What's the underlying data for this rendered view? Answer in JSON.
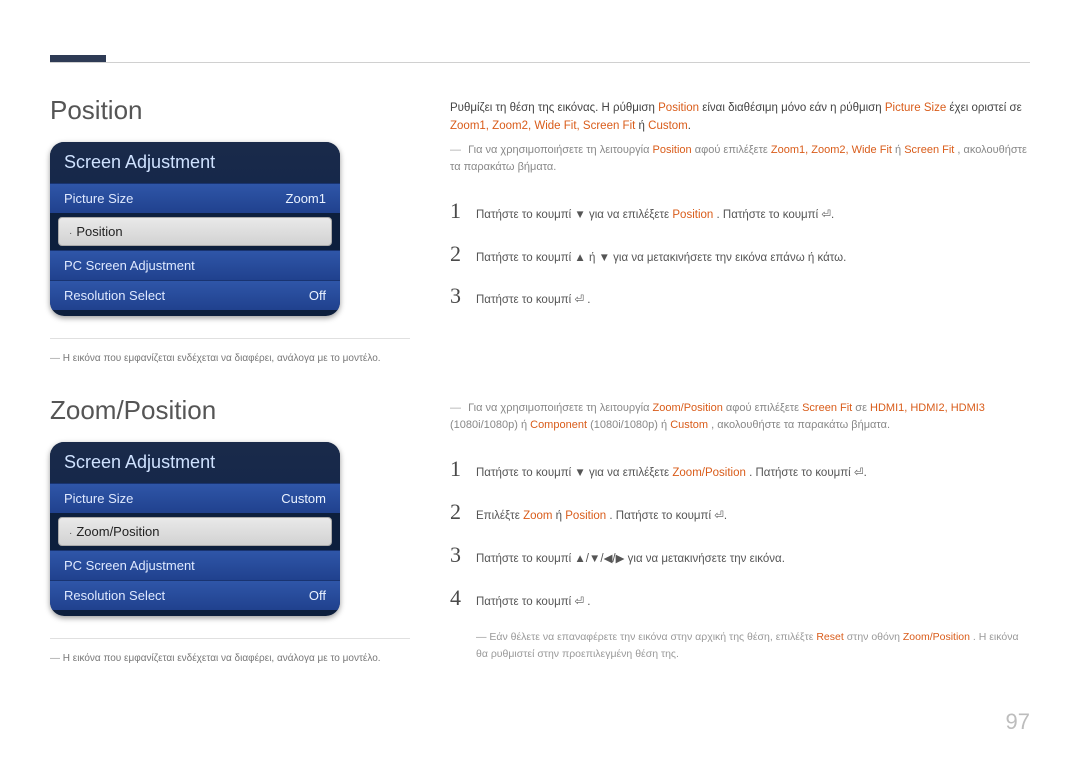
{
  "page_number": "97",
  "section1": {
    "title": "Position",
    "panel_title": "Screen Adjustment",
    "rows": [
      {
        "label": "Picture Size",
        "value": "Zoom1"
      },
      {
        "label": "Position"
      },
      {
        "label": "PC Screen Adjustment"
      },
      {
        "label": "Resolution Select",
        "value": "Off"
      }
    ],
    "note_prefix": "―",
    "note": "Η εικόνα που εμφανίζεται ενδέχεται να διαφέρει, ανάλογα με το μοντέλο.",
    "intro_a": "Ρυθμίζει τη θέση της εικόνας. Η ρύθμιση ",
    "intro_b": " είναι διαθέσιμη μόνο εάν η ρύθμιση ",
    "kw_position": "Position",
    "kw_picsize": "Picture Size",
    "intro_c": " έχει οριστεί σε ",
    "opts": "Zoom1, Zoom2, Wide Fit, Screen Fit",
    "intro_or": " ή ",
    "kw_custom": "Custom",
    "sub_a": "Για να χρησιμοποιήσετε τη λειτουργία ",
    "sub_b": " αφού επιλέξετε ",
    "sub_opts": "Zoom1, Zoom2, Wide Fit",
    "sub_or": " ή ",
    "kw_screenfit": "Screen Fit",
    "sub_c": ", ακολουθήστε τα παρακάτω βήματα.",
    "steps": {
      "s1a": "Πατήστε το κουμπί ▼ για να επιλέξετε ",
      "s1b": ". Πατήστε το κουμπί ",
      "enter": "↵",
      "s2": "Πατήστε το κουμπί ▲ ή ▼ για να μετακινήσετε την εικόνα επάνω ή κάτω.",
      "s3a": "Πατήστε το κουμπί ",
      "s3b": "."
    }
  },
  "section2": {
    "title": "Zoom/Position",
    "panel_title": "Screen Adjustment",
    "rows": [
      {
        "label": "Picture Size",
        "value": "Custom"
      },
      {
        "label": "Zoom/Position"
      },
      {
        "label": "PC Screen Adjustment"
      },
      {
        "label": "Resolution Select",
        "value": "Off"
      }
    ],
    "note_prefix": "―",
    "note": "Η εικόνα που εμφανίζεται ενδέχεται να διαφέρει, ανάλογα με το μοντέλο.",
    "sub_a": "Για να χρησιμοποιήσετε τη λειτουργία ",
    "kw_zp": "Zoom/Position",
    "sub_b": " αφού επιλέξετε ",
    "kw_screenfit": "Screen Fit",
    "sub_c": " σε ",
    "kw_hdmi": "HDMI1, HDMI2, HDMI3",
    "sub_d": " (1080i/1080p) ή ",
    "kw_component": "Component",
    "sub_e": " (1080i/1080p) ή ",
    "kw_custom": "Custom",
    "sub_f": ", ακολουθήστε τα παρακάτω βήματα.",
    "steps": {
      "s1a": "Πατήστε το κουμπί ▼ για να επιλέξετε ",
      "s1b": ". Πατήστε το κουμπί ",
      "enter": "↵",
      "s2a": "Επιλέξτε ",
      "kw_zoom": "Zoom",
      "s2or": " ή ",
      "kw_position": "Position",
      "s2b": ". Πατήστε το κουμπί ",
      "s3": "Πατήστε το κουμπί ▲/▼/◀/▶ για να μετακινήσετε την εικόνα.",
      "s4a": "Πατήστε το κουμπί ",
      "s4b": "."
    },
    "foot_a": "Εάν θέλετε να επαναφέρετε την εικόνα στην αρχική της θέση, επιλέξτε ",
    "kw_reset": "Reset",
    "foot_b": " στην οθόνη ",
    "foot_c": ". Η εικόνα θα ρυθμιστεί στην προεπιλεγμένη θέση της."
  },
  "icons": {
    "enter_symbol": "⏎"
  }
}
